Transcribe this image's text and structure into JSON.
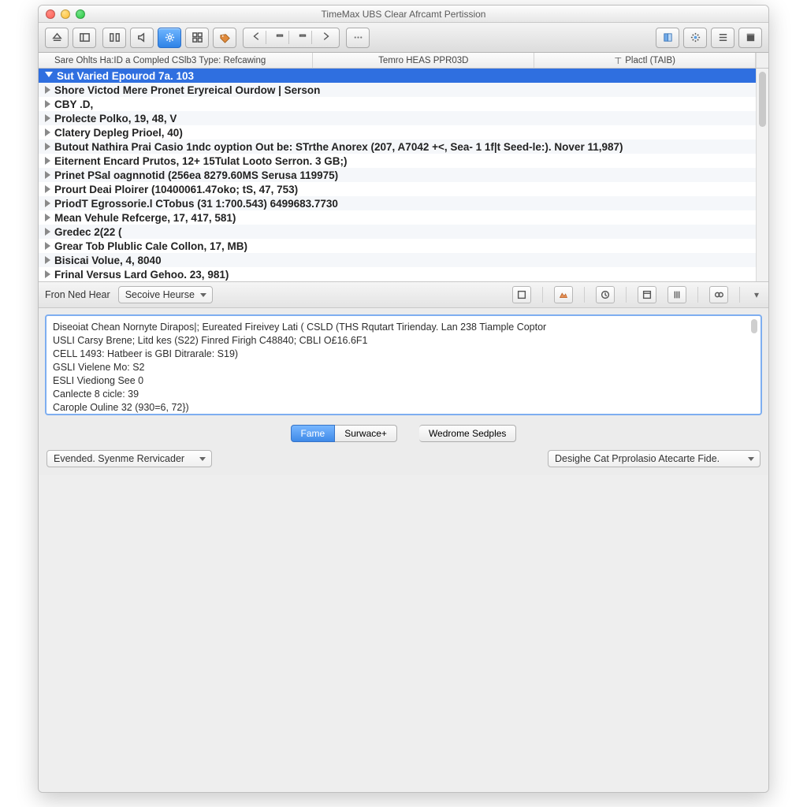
{
  "window": {
    "title": "TimeMax UBS Clear Afrcamt Pertission"
  },
  "columns": {
    "c1": "Sare Ohlts Ha:ID a Compled CSlb3 Type: Refcawing",
    "c2": "Temro HEAS PPR03D",
    "c3": "Plactl (TAIB)"
  },
  "rows": [
    "Sut Varied Epourod 7a. 103",
    "Shore Victod Mere Pronet Eryreical Ourdow | Serson",
    "CBY .D,",
    "Prolecte Polko, 19, 48, V",
    "Clatery Depleg Prioel, 40)",
    "Butout Nathira Prai Casio 1ndc oyption Out be: STrthe Anorex (207, A7042 +<, Sea- 1 1f|t Seed-le:). Nover 11,987)",
    "Eiternent Encard Prutos, 12+ 15Tulat Looto Serron. 3 GB;)  ",
    "Prinet PSal oagnnotid (256ea 8279.60MS Serusa 119975)",
    "Prourt Deai Ploirer (10400061.47oko; tS, 47, 753)",
    "PriodT Egrossorie.l CTobus (31 1:700.543) 6499683.7730",
    "Mean Vehule Refcerge, 17, 417, 581)",
    "Gredec 2(22 (",
    "Grear Tob Plublic Cale Collon, 17, MB)",
    "Bisicai Volue, 4, 8040",
    "Frinal Versus Lard Gehoo. 23, 981)"
  ],
  "midbar": {
    "label": "Fron Ned Hear",
    "select": "Secoive Heurse"
  },
  "detail": {
    "l1": "Diseoiat Chean Nornyte Dirapos|; Eureated Fireivey Lati ( CSLD (THS Rqutart Tirienday. Lan 238 Tiample Coptor",
    "l2": "USLI Carsy Brene; Litd kes (S22) Finred Firigh C48840; CBLI O£16.6F1",
    "l3": "CELL 1493: Hatbeer is GBI Ditrarale: S19)",
    "l4": "GSLI Vielene Mo: S2",
    "l5": "ESLI Viediong See 0",
    "l6": "Canlecte 8 cicle: 39",
    "l7": "Carople Ouline 32 (930=6, 72})"
  },
  "seg": {
    "a1": "Fame",
    "a2": "Surwace+",
    "b1": "Wedrome Sedples"
  },
  "bottom": {
    "left": "Evended. Syenme Rervicader",
    "right": "Desighe Cat Prprolasio Atecarte Fide."
  }
}
